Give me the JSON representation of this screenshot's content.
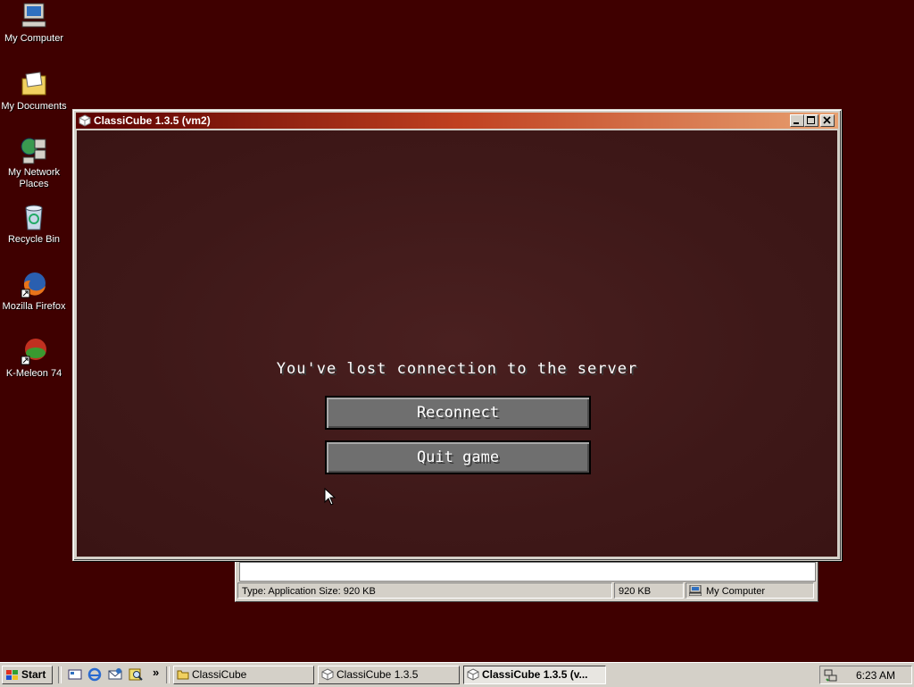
{
  "desktop_icons": [
    {
      "label": "My Computer",
      "icon": "my-computer-icon"
    },
    {
      "label": "My Documents",
      "icon": "my-documents-icon"
    },
    {
      "label": "My Network Places",
      "icon": "network-places-icon"
    },
    {
      "label": "Recycle Bin",
      "icon": "recycle-bin-icon"
    },
    {
      "label": "Mozilla Firefox",
      "icon": "firefox-icon"
    },
    {
      "label": "K-Meleon 74",
      "icon": "k-meleon-icon"
    }
  ],
  "window": {
    "title": "ClassiCube 1.3.5 (vm2)",
    "message": "You've lost connection to the server",
    "reconnect_label": "Reconnect",
    "quit_label": "Quit game"
  },
  "background_window": {
    "status_type": "Type: Application Size: 920 KB",
    "status_size": "920 KB",
    "status_location": "My Computer"
  },
  "taskbar": {
    "start_label": "Start",
    "more_symbol": "»",
    "tasks": [
      {
        "label": "ClassiCube",
        "icon": "folder-icon"
      },
      {
        "label": "ClassiCube 1.3.5",
        "icon": "cube-icon"
      },
      {
        "label": "ClassiCube 1.3.5 (v...",
        "icon": "cube-icon"
      }
    ],
    "clock": "6:23 AM"
  },
  "colors": {
    "desktop": "#3f0000",
    "titlebar_start": "#5a0000",
    "titlebar_end": "#e8a070",
    "game_bg": "#3e1818"
  }
}
